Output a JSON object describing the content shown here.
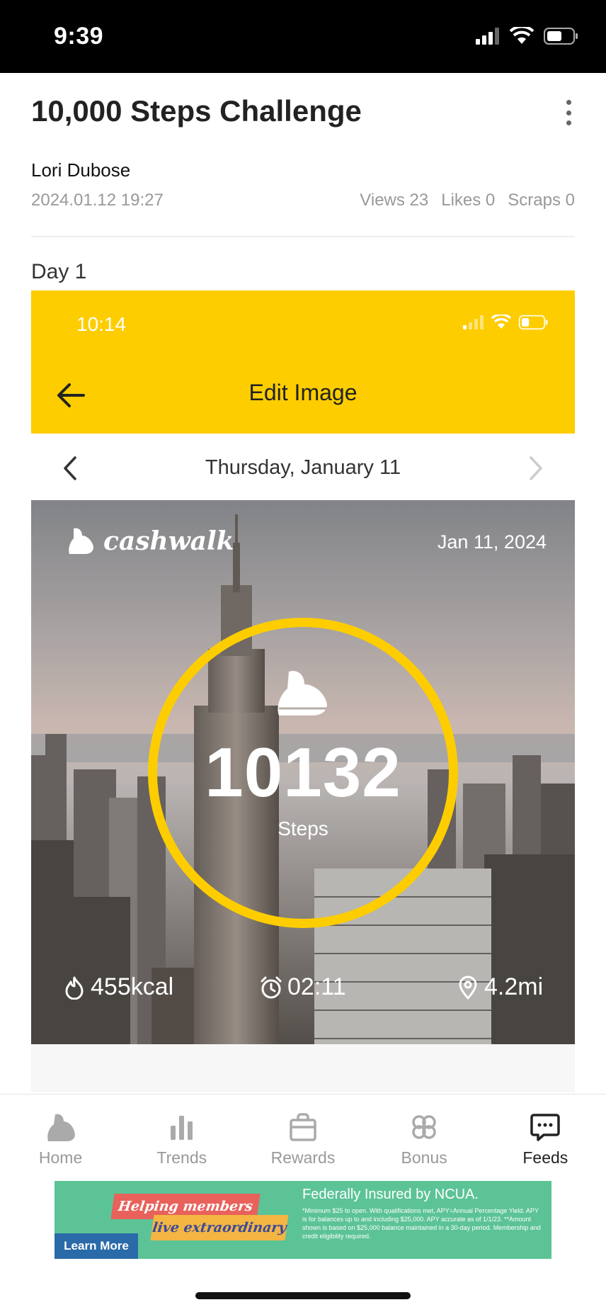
{
  "status_bar": {
    "time": "9:39"
  },
  "post": {
    "title": "10,000 Steps Challenge",
    "author": "Lori Dubose",
    "date": "2024.01.12 19:27",
    "stats": {
      "views": "Views 23",
      "likes": "Likes 0",
      "scraps": "Scraps 0"
    },
    "day_label": "Day 1"
  },
  "embedded_screenshot": {
    "status_time": "10:14",
    "header_title": "Edit Image",
    "date": "Thursday, January 11",
    "card": {
      "brand": "cashwalk",
      "date": "Jan 11, 2024",
      "steps": "10132",
      "steps_label": "Steps",
      "calories": "455kcal",
      "duration": "02:11",
      "distance": "4.2mi",
      "ring_color": "#fdcd00"
    },
    "header_color": "#fdcd00"
  },
  "tab_bar": {
    "tabs": [
      {
        "label": "Home",
        "icon": "shoe-icon",
        "active": false
      },
      {
        "label": "Trends",
        "icon": "bar-chart-icon",
        "active": false
      },
      {
        "label": "Rewards",
        "icon": "shopping-bag-icon",
        "active": false
      },
      {
        "label": "Bonus",
        "icon": "clover-icon",
        "active": false
      },
      {
        "label": "Feeds",
        "icon": "chat-bubble-icon",
        "active": true
      }
    ]
  },
  "ad": {
    "pill_1": "Helping members",
    "pill_2": "live extraordinary",
    "button": "Learn More",
    "headline": "Federally Insured by NCUA.",
    "fine_print": "*Minimum $25 to open. With qualifications met, APY=Annual Percentage Yield. APY is for balances up to and including $25,000. APY accurate as of 1/1/23. **Amount shown is based on $25,000 balance maintained in a 30-day period. Membership and credit eligibility required."
  }
}
